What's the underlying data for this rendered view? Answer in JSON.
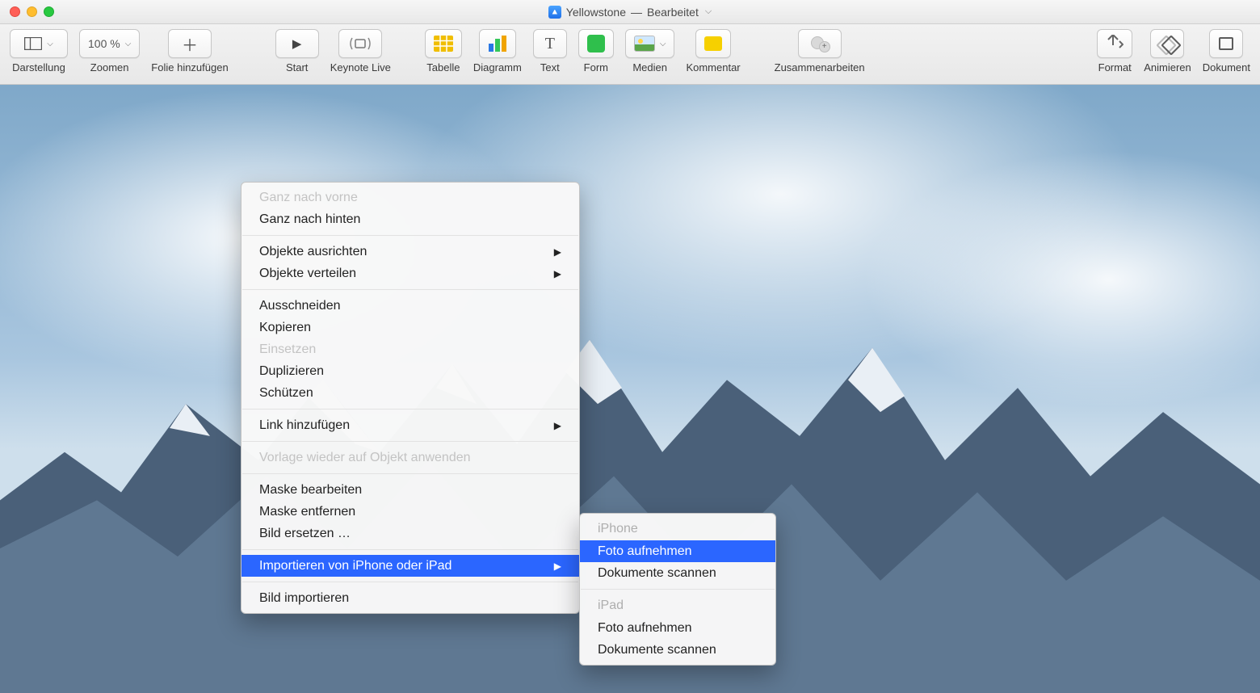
{
  "title": {
    "document": "Yellowstone",
    "status": "Bearbeitet"
  },
  "toolbar": {
    "view": "Darstellung",
    "zoom_label": "Zoomen",
    "zoom_value": "100 %",
    "add_slide": "Folie hinzufügen",
    "start": "Start",
    "keynote_live": "Keynote Live",
    "table": "Tabelle",
    "chart": "Diagramm",
    "text": "Text",
    "shape": "Form",
    "media": "Medien",
    "comment": "Kommentar",
    "collaborate": "Zusammenarbeiten",
    "format": "Format",
    "animate": "Animieren",
    "document": "Dokument"
  },
  "context_menu": {
    "bring_front": "Ganz nach vorne",
    "send_back": "Ganz nach hinten",
    "align": "Objekte ausrichten",
    "distribute": "Objekte verteilen",
    "cut": "Ausschneiden",
    "copy": "Kopieren",
    "paste": "Einsetzen",
    "duplicate": "Duplizieren",
    "protect": "Schützen",
    "add_link": "Link hinzufügen",
    "reapply_template": "Vorlage wieder auf Objekt anwenden",
    "edit_mask": "Maske bearbeiten",
    "remove_mask": "Maske entfernen",
    "replace_image": "Bild ersetzen …",
    "import_device": "Importieren von iPhone oder iPad",
    "import_image": "Bild importieren"
  },
  "submenu": {
    "iphone_header": "iPhone",
    "take_photo_1": "Foto aufnehmen",
    "scan_docs_1": "Dokumente scannen",
    "ipad_header": "iPad",
    "take_photo_2": "Foto aufnehmen",
    "scan_docs_2": "Dokumente scannen"
  }
}
